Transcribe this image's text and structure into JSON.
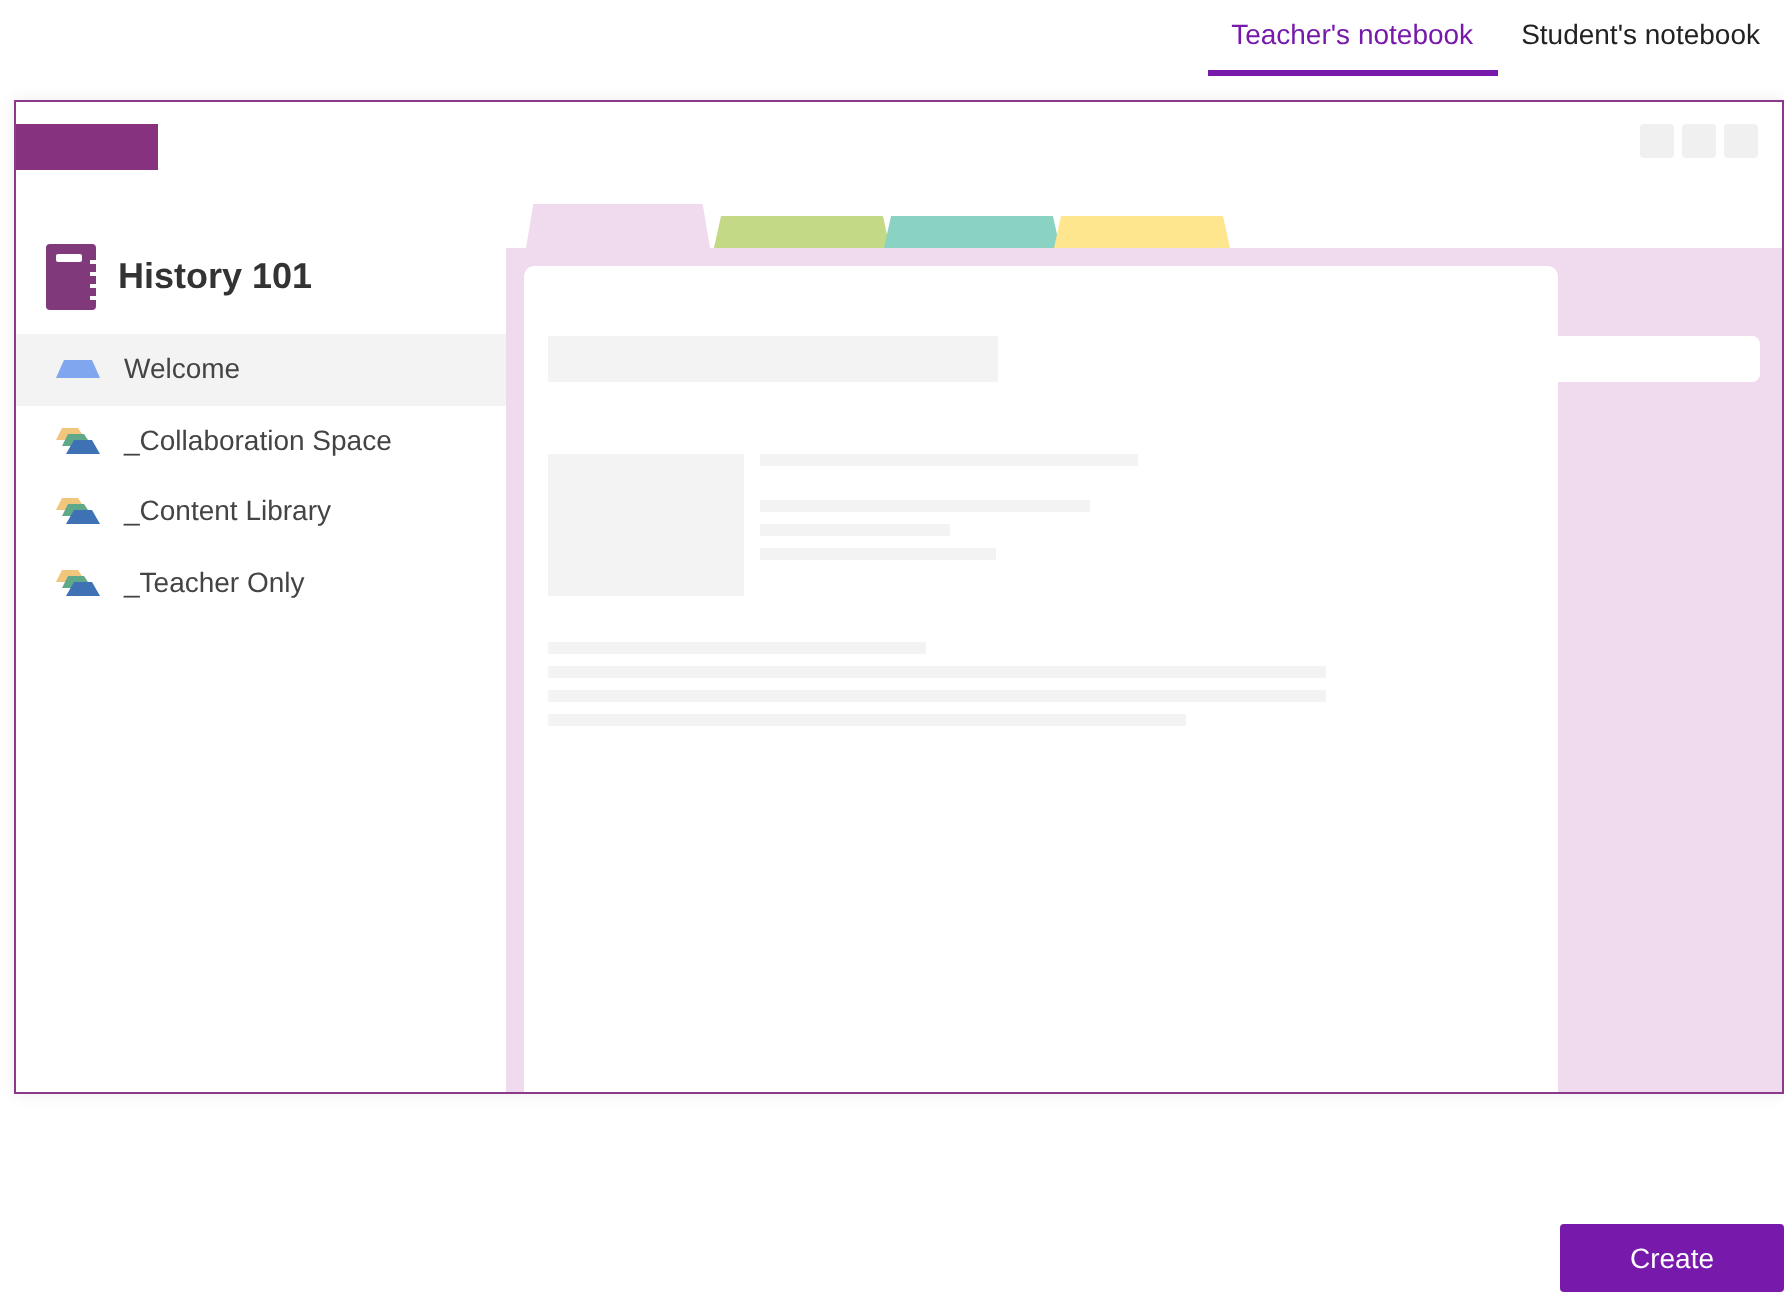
{
  "tabs": [
    {
      "label": "Teacher's notebook",
      "selected": true
    },
    {
      "label": "Student's notebook",
      "selected": false
    }
  ],
  "preview": {
    "notebook": {
      "title": "History 101"
    },
    "sections": [
      {
        "label": "Welcome",
        "kind": "section",
        "selected": true
      },
      {
        "label": "_Collaboration Space",
        "kind": "group",
        "selected": false
      },
      {
        "label": "_Content Library",
        "kind": "group",
        "selected": false
      },
      {
        "label": "_Teacher Only",
        "kind": "group",
        "selected": false
      }
    ],
    "page_tabs": [
      {
        "color": "#f0daee",
        "selected": true
      },
      {
        "color": "#c3d985",
        "selected": false
      },
      {
        "color": "#8ad3c3",
        "selected": false
      },
      {
        "color": "#fee68e",
        "selected": false
      }
    ]
  },
  "buttons": [
    {
      "label": "Create"
    }
  ]
}
